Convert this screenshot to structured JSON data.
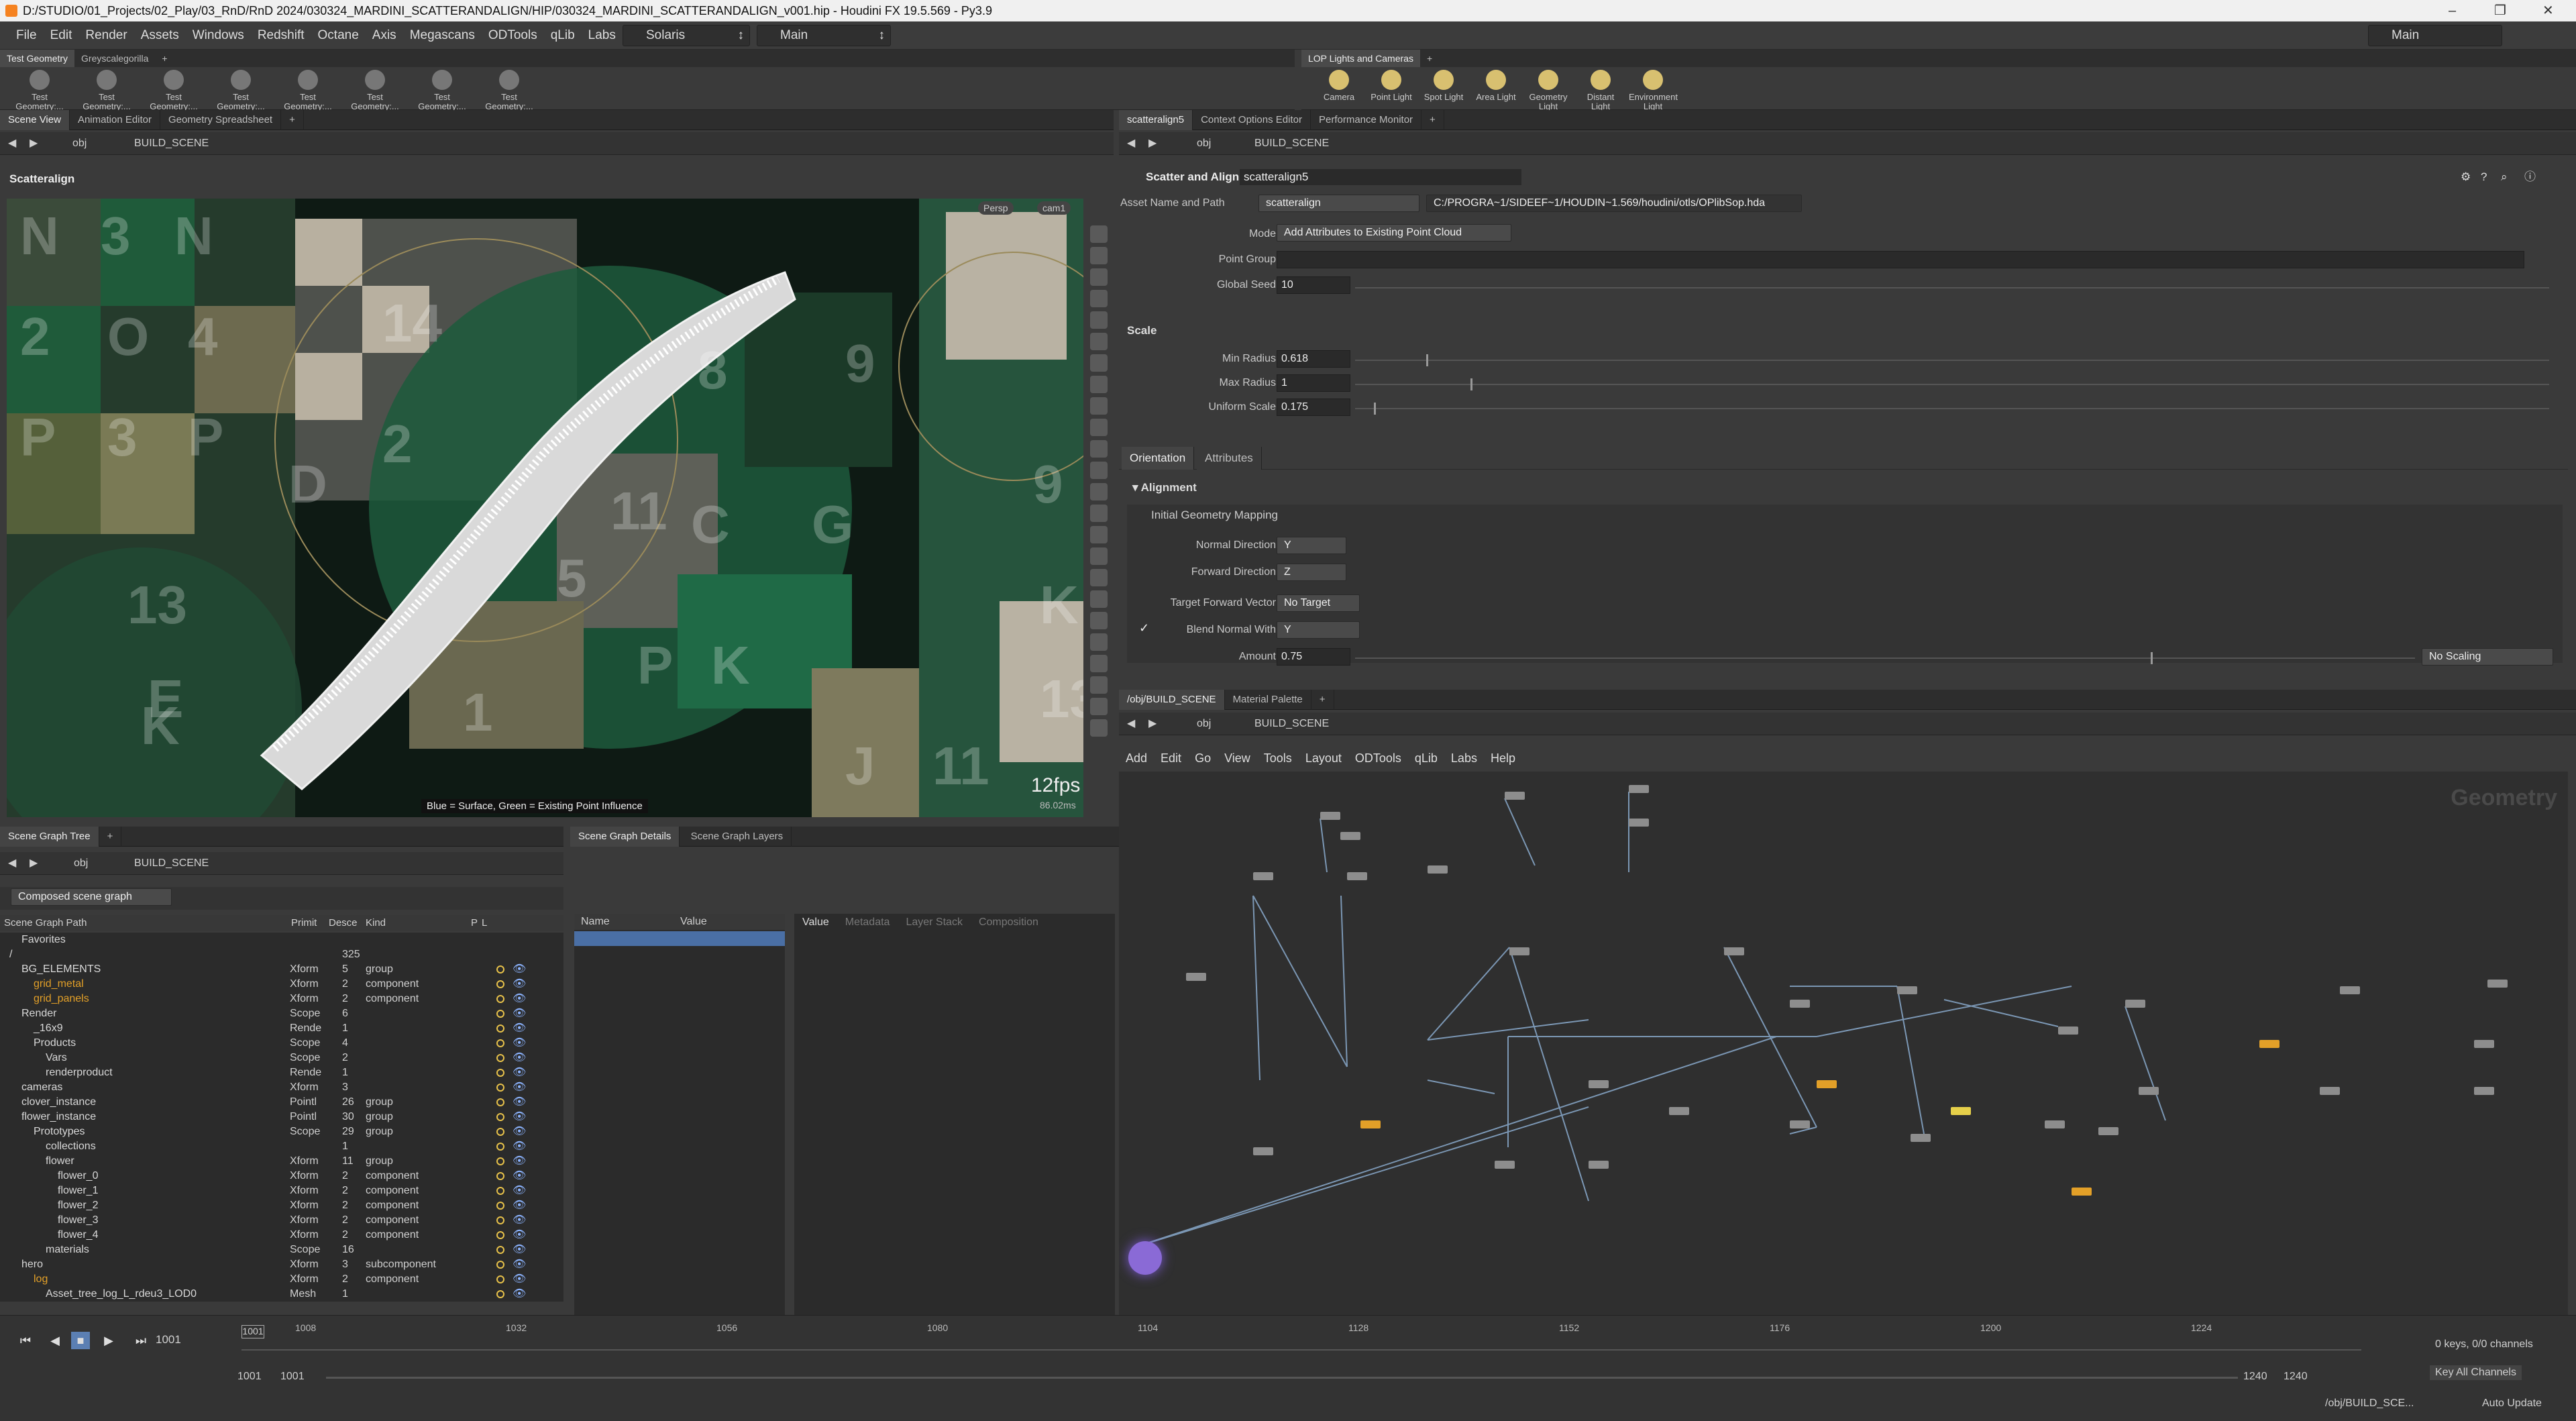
{
  "titlebar": {
    "title": "D:/STUDIO/01_Projects/02_Play/03_RnD/RnD 2024/030324_MARDINI_SCATTERANDALIGN/HIP/030324_MARDINI_SCATTERANDALIGN_v001.hip - Houdini FX 19.5.569 - Py3.9"
  },
  "menu": {
    "items": [
      "File",
      "Edit",
      "Render",
      "Assets",
      "Windows",
      "Redshift",
      "Octane",
      "Axis",
      "Megascans",
      "ODTools",
      "qLib",
      "Labs",
      "Help"
    ],
    "desktop": "Solaris",
    "context": "Main",
    "right_context": "Main"
  },
  "shelf_left": {
    "tabs": [
      "Test Geometry",
      "Greyscalegorilla"
    ],
    "tools": [
      "Test Geometry:...",
      "Test Geometry:...",
      "Test Geometry:...",
      "Test Geometry:...",
      "Test Geometry:...",
      "Test Geometry:...",
      "Test Geometry:...",
      "Test Geometry:..."
    ]
  },
  "shelf_right": {
    "tabs": [
      "LOP Lights and Cameras"
    ],
    "tools": [
      "Camera",
      "Point Light",
      "Spot Light",
      "Area Light",
      "Geometry Light",
      "Distant Light",
      "Environment Light"
    ]
  },
  "left_tabs": [
    "Scene View",
    "Animation Editor",
    "Geometry Spreadsheet"
  ],
  "left_path": {
    "root": "obj",
    "node": "BUILD_SCENE"
  },
  "viewport": {
    "title": "Scatteralign",
    "persp": "Persp",
    "cam": "cam1",
    "fps": "12fps",
    "ms": "86.02ms",
    "hint": "Blue = Surface, Green = Existing Point Influence",
    "tiles": [
      "N",
      "3",
      "N",
      "2",
      "O",
      "4",
      "P",
      "3",
      "P",
      "14",
      "2",
      "D",
      "8",
      "11",
      "C",
      "G",
      "9",
      "5",
      "13",
      "E",
      "P",
      "K",
      "J",
      "K",
      "13",
      "K",
      "1",
      "11",
      "9"
    ]
  },
  "param_tabs": [
    "scatteralign5",
    "Context Options Editor",
    "Performance Monitor"
  ],
  "param_path": {
    "root": "obj",
    "node": "BUILD_SCENE"
  },
  "params": {
    "node_type": "Scatter and Align",
    "node_name": "scatteralign5",
    "asset_label": "Asset Name and Path",
    "asset_name": "scatteralign",
    "asset_path": "C:/PROGRA~1/SIDEEF~1/HOUDIN~1.569/houdini/otls/OPlibSop.hda",
    "mode_label": "Mode",
    "mode_value": "Add Attributes to Existing Point Cloud",
    "point_group_label": "Point Group",
    "point_group_value": "",
    "seed_label": "Global Seed",
    "seed_value": "10",
    "scale_section": "Scale",
    "min_radius_label": "Min Radius",
    "min_radius_value": "0.618",
    "max_radius_label": "Max Radius",
    "max_radius_value": "1",
    "uniform_scale_label": "Uniform Scale",
    "uniform_scale_value": "0.175",
    "tabs": [
      "Orientation",
      "Attributes"
    ],
    "alignment_section": "Alignment",
    "initial_mapping": "Initial Geometry Mapping",
    "normal_dir_label": "Normal Direction",
    "normal_dir_value": "Y",
    "forward_dir_label": "Forward Direction",
    "forward_dir_value": "Z",
    "target_fwd_label": "Target Forward Vector",
    "target_fwd_value": "No Target",
    "blend_normal_label": "Blend Normal With",
    "blend_normal_value": "Y",
    "amount_label": "Amount",
    "amount_value": "0.75",
    "amount_mode": "No Scaling"
  },
  "network": {
    "tabs": [
      "/obj/BUILD_SCENE",
      "Material Palette"
    ],
    "path_root": "obj",
    "path_node": "BUILD_SCENE",
    "menu": [
      "Add",
      "Edit",
      "Go",
      "View",
      "Tools",
      "Layout",
      "ODTools",
      "qLib",
      "Labs",
      "Help"
    ],
    "watermark": "Geometry"
  },
  "sg_tabs": [
    "Scene Graph Tree"
  ],
  "sg_details_tabs": [
    "Scene Graph Details",
    "Scene Graph Layers"
  ],
  "sg_path": {
    "root": "obj",
    "node": "BUILD_SCENE"
  },
  "sg_toolbar": {
    "mode": "Composed scene graph"
  },
  "sg_headers": {
    "path": "Scene Graph Path",
    "prim": "Primit",
    "desc": "Desce",
    "kind": "Kind",
    "p": "P",
    "l": "L"
  },
  "sg_rows": [
    {
      "name": "Favorites",
      "type": "",
      "desc": "",
      "kind": "",
      "indent": 1
    },
    {
      "name": "/",
      "type": "",
      "desc": "325",
      "kind": "",
      "indent": 0
    },
    {
      "name": "BG_ELEMENTS",
      "type": "Xform",
      "desc": "5",
      "kind": "group",
      "indent": 1
    },
    {
      "name": "grid_metal",
      "type": "Xform",
      "desc": "2",
      "kind": "component",
      "indent": 2,
      "orange": true
    },
    {
      "name": "grid_panels",
      "type": "Xform",
      "desc": "2",
      "kind": "component",
      "indent": 2,
      "orange": true
    },
    {
      "name": "Render",
      "type": "Scope",
      "desc": "6",
      "kind": "",
      "indent": 1
    },
    {
      "name": "_16x9",
      "type": "Rende",
      "desc": "1",
      "kind": "",
      "indent": 2
    },
    {
      "name": "Products",
      "type": "Scope",
      "desc": "4",
      "kind": "",
      "indent": 2
    },
    {
      "name": "Vars",
      "type": "Scope",
      "desc": "2",
      "kind": "",
      "indent": 3
    },
    {
      "name": "renderproduct",
      "type": "Rende",
      "desc": "1",
      "kind": "",
      "indent": 3
    },
    {
      "name": "cameras",
      "type": "Xform",
      "desc": "3",
      "kind": "",
      "indent": 1
    },
    {
      "name": "clover_instance",
      "type": "Pointl",
      "desc": "26",
      "kind": "group",
      "indent": 1
    },
    {
      "name": "flower_instance",
      "type": "Pointl",
      "desc": "30",
      "kind": "group",
      "indent": 1
    },
    {
      "name": "Prototypes",
      "type": "Scope",
      "desc": "29",
      "kind": "group",
      "indent": 2
    },
    {
      "name": "collections",
      "type": "",
      "desc": "1",
      "kind": "",
      "indent": 3
    },
    {
      "name": "flower",
      "type": "Xform",
      "desc": "11",
      "kind": "group",
      "indent": 3
    },
    {
      "name": "flower_0",
      "type": "Xform",
      "desc": "2",
      "kind": "component",
      "indent": 4
    },
    {
      "name": "flower_1",
      "type": "Xform",
      "desc": "2",
      "kind": "component",
      "indent": 4
    },
    {
      "name": "flower_2",
      "type": "Xform",
      "desc": "2",
      "kind": "component",
      "indent": 4
    },
    {
      "name": "flower_3",
      "type": "Xform",
      "desc": "2",
      "kind": "component",
      "indent": 4
    },
    {
      "name": "flower_4",
      "type": "Xform",
      "desc": "2",
      "kind": "component",
      "indent": 4
    },
    {
      "name": "materials",
      "type": "Scope",
      "desc": "16",
      "kind": "",
      "indent": 3
    },
    {
      "name": "hero",
      "type": "Xform",
      "desc": "3",
      "kind": "subcomponent",
      "indent": 1
    },
    {
      "name": "log",
      "type": "Xform",
      "desc": "2",
      "kind": "component",
      "indent": 2,
      "orange": true
    },
    {
      "name": "Asset_tree_log_L_rdeu3_LOD0",
      "type": "Mesh",
      "desc": "1",
      "kind": "",
      "indent": 3
    }
  ],
  "sg_details": {
    "name_h": "Name",
    "value_h": "Value",
    "tabs": [
      "Value",
      "Metadata",
      "Layer Stack",
      "Composition"
    ]
  },
  "timeline": {
    "frame": "1001",
    "start": "1001",
    "start2": "1001",
    "end": "1240",
    "end2": "1240",
    "ticks": [
      "1008",
      "1032",
      "1056",
      "1080",
      "1104",
      "1128",
      "1152",
      "1176",
      "1200",
      "1224"
    ],
    "keys": "0 keys, 0/0 channels",
    "key_all": "Key All Channels",
    "status_path": "/obj/BUILD_SCE...",
    "auto_update": "Auto Update"
  },
  "colors": {
    "accent": "#e3a028",
    "sel": "#4a6fa5",
    "bg": "#3a3a3a"
  }
}
